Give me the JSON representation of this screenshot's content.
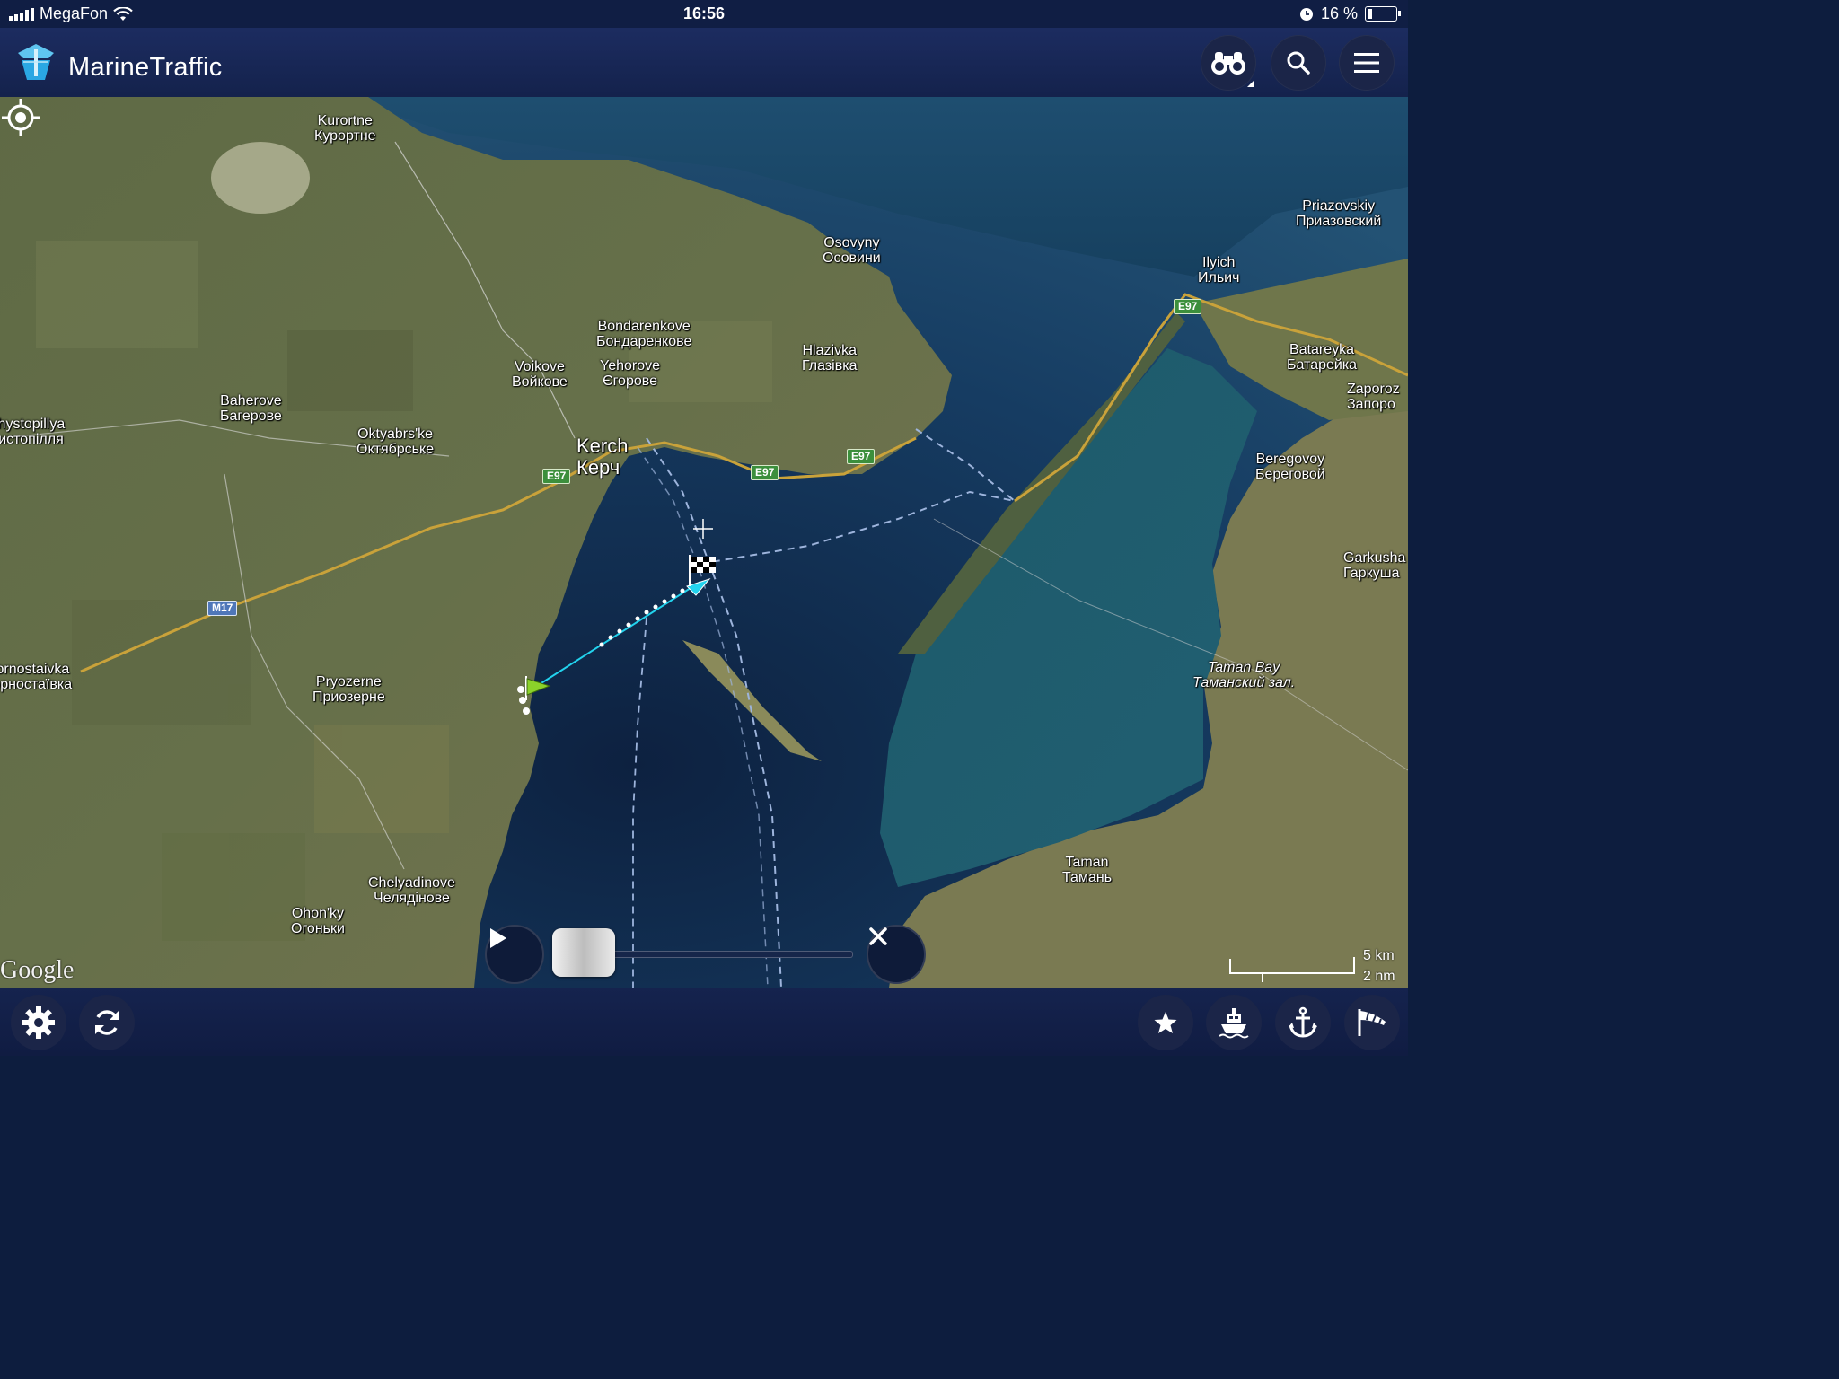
{
  "status": {
    "carrier": "MegaFon",
    "time": "16:56",
    "battery": "16 %"
  },
  "header": {
    "title": "MarineTraffic"
  },
  "map": {
    "places": [
      {
        "id": "kurortne",
        "lines": [
          "Kurortne",
          "Курортне"
        ]
      },
      {
        "id": "osovyny",
        "lines": [
          "Osovyny",
          "Осовини"
        ]
      },
      {
        "id": "priazovskiy",
        "lines": [
          "Priazovskiy",
          "Приазовский"
        ]
      },
      {
        "id": "ilyich",
        "lines": [
          "Ilyich",
          "Ильич"
        ]
      },
      {
        "id": "bondarenkove",
        "lines": [
          "Bondarenkove",
          "Бондаренкове"
        ]
      },
      {
        "id": "voikove",
        "lines": [
          "Voikove",
          "Войкове"
        ]
      },
      {
        "id": "yehorove",
        "lines": [
          "Yehorove",
          "Єгорове"
        ]
      },
      {
        "id": "hlazivka",
        "lines": [
          "Hlazivka",
          "Глазівка"
        ]
      },
      {
        "id": "batareyka",
        "lines": [
          "Batareyka",
          "Батарейка"
        ]
      },
      {
        "id": "zaporozh",
        "lines": [
          "Zaporoz",
          "Запоро"
        ]
      },
      {
        "id": "baherove",
        "lines": [
          "Baherove",
          "Багерове"
        ]
      },
      {
        "id": "chystopillya",
        "lines": [
          "Chystopillya",
          "Чистопілля"
        ]
      },
      {
        "id": "oktyabrske",
        "lines": [
          "Oktyabrs'ke",
          "Октябрське"
        ]
      },
      {
        "id": "kerch",
        "lines": [
          "Kerch",
          "Керч"
        ]
      },
      {
        "id": "beregovoy",
        "lines": [
          "Beregovoy",
          "Береговой"
        ]
      },
      {
        "id": "garkusha",
        "lines": [
          "Garkusha",
          "Гаркуша"
        ]
      },
      {
        "id": "kornostaivka",
        "lines": [
          "Kornostaivka",
          "Корностаївка"
        ]
      },
      {
        "id": "pryozerne",
        "lines": [
          "Pryozerne",
          "Приозерне"
        ]
      },
      {
        "id": "tamanbay",
        "lines": [
          "Taman Bay",
          "Таманский зал."
        ]
      },
      {
        "id": "taman",
        "lines": [
          "Taman",
          "Тамань"
        ]
      },
      {
        "id": "chelyadinove",
        "lines": [
          "Chelyadinove",
          "Челядінове"
        ]
      },
      {
        "id": "ohonky",
        "lines": [
          "Ohon'ky",
          "Огоньки"
        ]
      }
    ],
    "road_shields": {
      "e97_1": "E97",
      "e97_2": "E97",
      "e97_3": "E97",
      "e97_4": "E97",
      "m17": "M17"
    },
    "attribution": "Google",
    "scale": {
      "metric": "5 km",
      "nautical": "2 nm"
    },
    "colors": {
      "sea": "#123357",
      "track": "#22d3ee",
      "route": "#9db4dc",
      "road": "#c9a23a"
    }
  },
  "toolbar": {
    "top_icons": [
      "binoculars-icon",
      "search-icon",
      "menu-icon"
    ],
    "bottom_icons": [
      "gear-icon",
      "refresh-icon",
      "star-icon",
      "ship-icon",
      "anchor-icon",
      "wind-icon"
    ]
  }
}
